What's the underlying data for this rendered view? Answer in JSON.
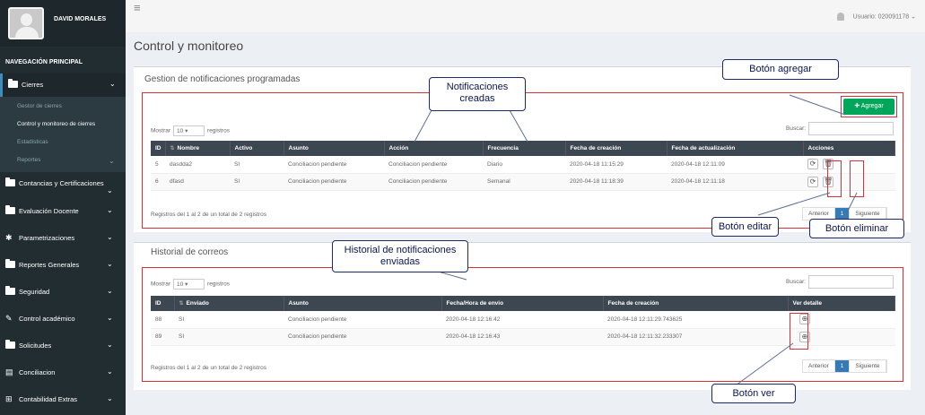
{
  "user": {
    "name": "DAVID MORALES"
  },
  "sidebar": {
    "header": "NAVEGACIÓN PRINCIPAL",
    "menu": [
      {
        "label": "Cierres"
      },
      {
        "label": "Contancias y Certificaciones"
      },
      {
        "label": "Evaluación Docente"
      },
      {
        "label": "Parametrizaciones"
      },
      {
        "label": "Reportes Generales"
      },
      {
        "label": "Seguridad"
      },
      {
        "label": "Control académico"
      },
      {
        "label": "Solicitudes"
      },
      {
        "label": "Conciliacion"
      },
      {
        "label": "Contabilidad Extras"
      }
    ],
    "submenu": [
      {
        "label": "Gestor de cierres"
      },
      {
        "label": "Control y monitoreo de cierres"
      },
      {
        "label": "Estadisticas"
      },
      {
        "label": "Reportes"
      }
    ]
  },
  "topbar": {
    "user_label": "Usuario: 020091178"
  },
  "page": {
    "title": "Control y monitoreo"
  },
  "notifications": {
    "title": "Gestion de notificaciones programadas",
    "add_label": "Agregar",
    "show_label": "Mostrar",
    "entries_value": "10",
    "records_label": "registros",
    "search_label": "Buscar:",
    "columns": [
      "ID",
      "Nombre",
      "Activo",
      "Asunto",
      "Acción",
      "Frecuencia",
      "Fecha de creación",
      "Fecha de actualización",
      "Acciones"
    ],
    "rows": [
      [
        "5",
        "dasdda2",
        "SI",
        "Conciliacion pendiente",
        "Conciliacion pendiente",
        "Diario",
        "2020-04-18 11:15:29",
        "2020-04-18 12:11:09"
      ],
      [
        "6",
        "dfasd",
        "SI",
        "Conciliacion pendiente",
        "Conciliacion pendiente",
        "Semanal",
        "2020-04-18 11:18:39",
        "2020-04-18 12:11:18"
      ]
    ],
    "info": "Registros del 1 al 2 de un total de 2 registros",
    "pager": {
      "prev": "Anterior",
      "page": "1",
      "next": "Siguiente"
    }
  },
  "history": {
    "title": "Historial de correos",
    "show_label": "Mostrar",
    "entries_value": "10",
    "records_label": "registros",
    "search_label": "Buscar:",
    "columns": [
      "ID",
      "Enviado",
      "Asunto",
      "Fecha/Hora de envio",
      "Fecha de creación",
      "Ver detalle"
    ],
    "rows": [
      [
        "88",
        "SI",
        "Conciliacion pendiente",
        "2020-04-18 12:16:42",
        "2020-04-18 12:11:29.743625"
      ],
      [
        "89",
        "SI",
        "Conciliacion pendiente",
        "2020-04-18 12:16:43",
        "2020-04-18 12:11:32.233307"
      ]
    ],
    "info": "Registros del 1 al 2 de un total de 2 registros",
    "pager": {
      "prev": "Anterior",
      "page": "1",
      "next": "Siguiente"
    }
  },
  "callouts": {
    "add": "Botón agregar",
    "created": "Notificaciones creadas",
    "edit": "Botón editar",
    "delete": "Botón eliminar",
    "history": "Historial de notificaciones enviadas",
    "view": "Botón ver"
  },
  "colors": {
    "sidebar": "#222d32",
    "header_row": "#3d4751",
    "add_button": "#00a65a",
    "highlight": "#d9313a",
    "callout_border": "#1c2a6b"
  }
}
